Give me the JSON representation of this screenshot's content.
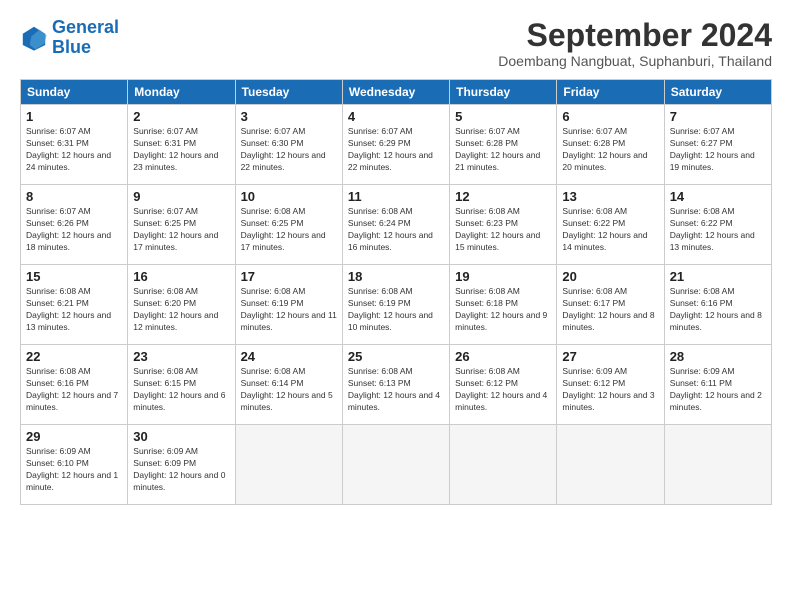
{
  "logo": {
    "line1": "General",
    "line2": "Blue"
  },
  "title": "September 2024",
  "subtitle": "Doembang Nangbuat, Suphanburi, Thailand",
  "headers": [
    "Sunday",
    "Monday",
    "Tuesday",
    "Wednesday",
    "Thursday",
    "Friday",
    "Saturday"
  ],
  "weeks": [
    [
      {
        "day": 1,
        "sunrise": "6:07 AM",
        "sunset": "6:31 PM",
        "daylight": "12 hours and 24 minutes."
      },
      {
        "day": 2,
        "sunrise": "6:07 AM",
        "sunset": "6:31 PM",
        "daylight": "12 hours and 23 minutes."
      },
      {
        "day": 3,
        "sunrise": "6:07 AM",
        "sunset": "6:30 PM",
        "daylight": "12 hours and 22 minutes."
      },
      {
        "day": 4,
        "sunrise": "6:07 AM",
        "sunset": "6:29 PM",
        "daylight": "12 hours and 22 minutes."
      },
      {
        "day": 5,
        "sunrise": "6:07 AM",
        "sunset": "6:28 PM",
        "daylight": "12 hours and 21 minutes."
      },
      {
        "day": 6,
        "sunrise": "6:07 AM",
        "sunset": "6:28 PM",
        "daylight": "12 hours and 20 minutes."
      },
      {
        "day": 7,
        "sunrise": "6:07 AM",
        "sunset": "6:27 PM",
        "daylight": "12 hours and 19 minutes."
      }
    ],
    [
      {
        "day": 8,
        "sunrise": "6:07 AM",
        "sunset": "6:26 PM",
        "daylight": "12 hours and 18 minutes."
      },
      {
        "day": 9,
        "sunrise": "6:07 AM",
        "sunset": "6:25 PM",
        "daylight": "12 hours and 17 minutes."
      },
      {
        "day": 10,
        "sunrise": "6:08 AM",
        "sunset": "6:25 PM",
        "daylight": "12 hours and 17 minutes."
      },
      {
        "day": 11,
        "sunrise": "6:08 AM",
        "sunset": "6:24 PM",
        "daylight": "12 hours and 16 minutes."
      },
      {
        "day": 12,
        "sunrise": "6:08 AM",
        "sunset": "6:23 PM",
        "daylight": "12 hours and 15 minutes."
      },
      {
        "day": 13,
        "sunrise": "6:08 AM",
        "sunset": "6:22 PM",
        "daylight": "12 hours and 14 minutes."
      },
      {
        "day": 14,
        "sunrise": "6:08 AM",
        "sunset": "6:22 PM",
        "daylight": "12 hours and 13 minutes."
      }
    ],
    [
      {
        "day": 15,
        "sunrise": "6:08 AM",
        "sunset": "6:21 PM",
        "daylight": "12 hours and 13 minutes."
      },
      {
        "day": 16,
        "sunrise": "6:08 AM",
        "sunset": "6:20 PM",
        "daylight": "12 hours and 12 minutes."
      },
      {
        "day": 17,
        "sunrise": "6:08 AM",
        "sunset": "6:19 PM",
        "daylight": "12 hours and 11 minutes."
      },
      {
        "day": 18,
        "sunrise": "6:08 AM",
        "sunset": "6:19 PM",
        "daylight": "12 hours and 10 minutes."
      },
      {
        "day": 19,
        "sunrise": "6:08 AM",
        "sunset": "6:18 PM",
        "daylight": "12 hours and 9 minutes."
      },
      {
        "day": 20,
        "sunrise": "6:08 AM",
        "sunset": "6:17 PM",
        "daylight": "12 hours and 8 minutes."
      },
      {
        "day": 21,
        "sunrise": "6:08 AM",
        "sunset": "6:16 PM",
        "daylight": "12 hours and 8 minutes."
      }
    ],
    [
      {
        "day": 22,
        "sunrise": "6:08 AM",
        "sunset": "6:16 PM",
        "daylight": "12 hours and 7 minutes."
      },
      {
        "day": 23,
        "sunrise": "6:08 AM",
        "sunset": "6:15 PM",
        "daylight": "12 hours and 6 minutes."
      },
      {
        "day": 24,
        "sunrise": "6:08 AM",
        "sunset": "6:14 PM",
        "daylight": "12 hours and 5 minutes."
      },
      {
        "day": 25,
        "sunrise": "6:08 AM",
        "sunset": "6:13 PM",
        "daylight": "12 hours and 4 minutes."
      },
      {
        "day": 26,
        "sunrise": "6:08 AM",
        "sunset": "6:12 PM",
        "daylight": "12 hours and 4 minutes."
      },
      {
        "day": 27,
        "sunrise": "6:09 AM",
        "sunset": "6:12 PM",
        "daylight": "12 hours and 3 minutes."
      },
      {
        "day": 28,
        "sunrise": "6:09 AM",
        "sunset": "6:11 PM",
        "daylight": "12 hours and 2 minutes."
      }
    ],
    [
      {
        "day": 29,
        "sunrise": "6:09 AM",
        "sunset": "6:10 PM",
        "daylight": "12 hours and 1 minute."
      },
      {
        "day": 30,
        "sunrise": "6:09 AM",
        "sunset": "6:09 PM",
        "daylight": "12 hours and 0 minutes."
      },
      null,
      null,
      null,
      null,
      null
    ]
  ]
}
